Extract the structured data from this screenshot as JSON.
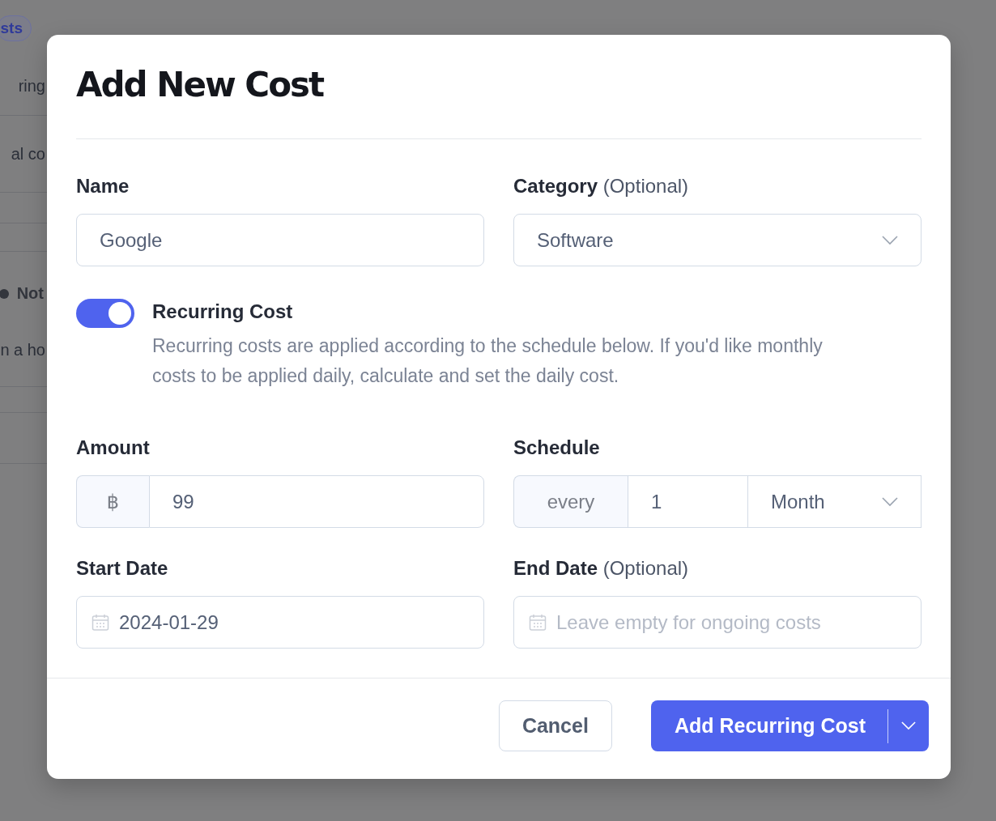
{
  "background": {
    "badge": "sts",
    "texts": [
      "ring",
      "al co"
    ],
    "status": "Not",
    "note": "n a ho"
  },
  "dialog": {
    "title": "Add New Cost",
    "name": {
      "label": "Name",
      "value": "Google"
    },
    "category": {
      "label": "Category",
      "hint": "(Optional)",
      "value": "Software"
    },
    "recurring": {
      "on": true,
      "label": "Recurring Cost",
      "description": "Recurring costs are applied according to the schedule below. If you'd like monthly costs to be applied daily, calculate and set the daily cost."
    },
    "amount": {
      "label": "Amount",
      "prefix": "฿",
      "value": "99"
    },
    "schedule": {
      "label": "Schedule",
      "prefix": "every",
      "interval": "1",
      "unit": "Month"
    },
    "start_date": {
      "label": "Start Date",
      "value": "2024-01-29"
    },
    "end_date": {
      "label": "End Date",
      "hint": "(Optional)",
      "placeholder": "Leave empty for ongoing costs"
    },
    "buttons": {
      "cancel": "Cancel",
      "submit": "Add Recurring Cost"
    }
  }
}
